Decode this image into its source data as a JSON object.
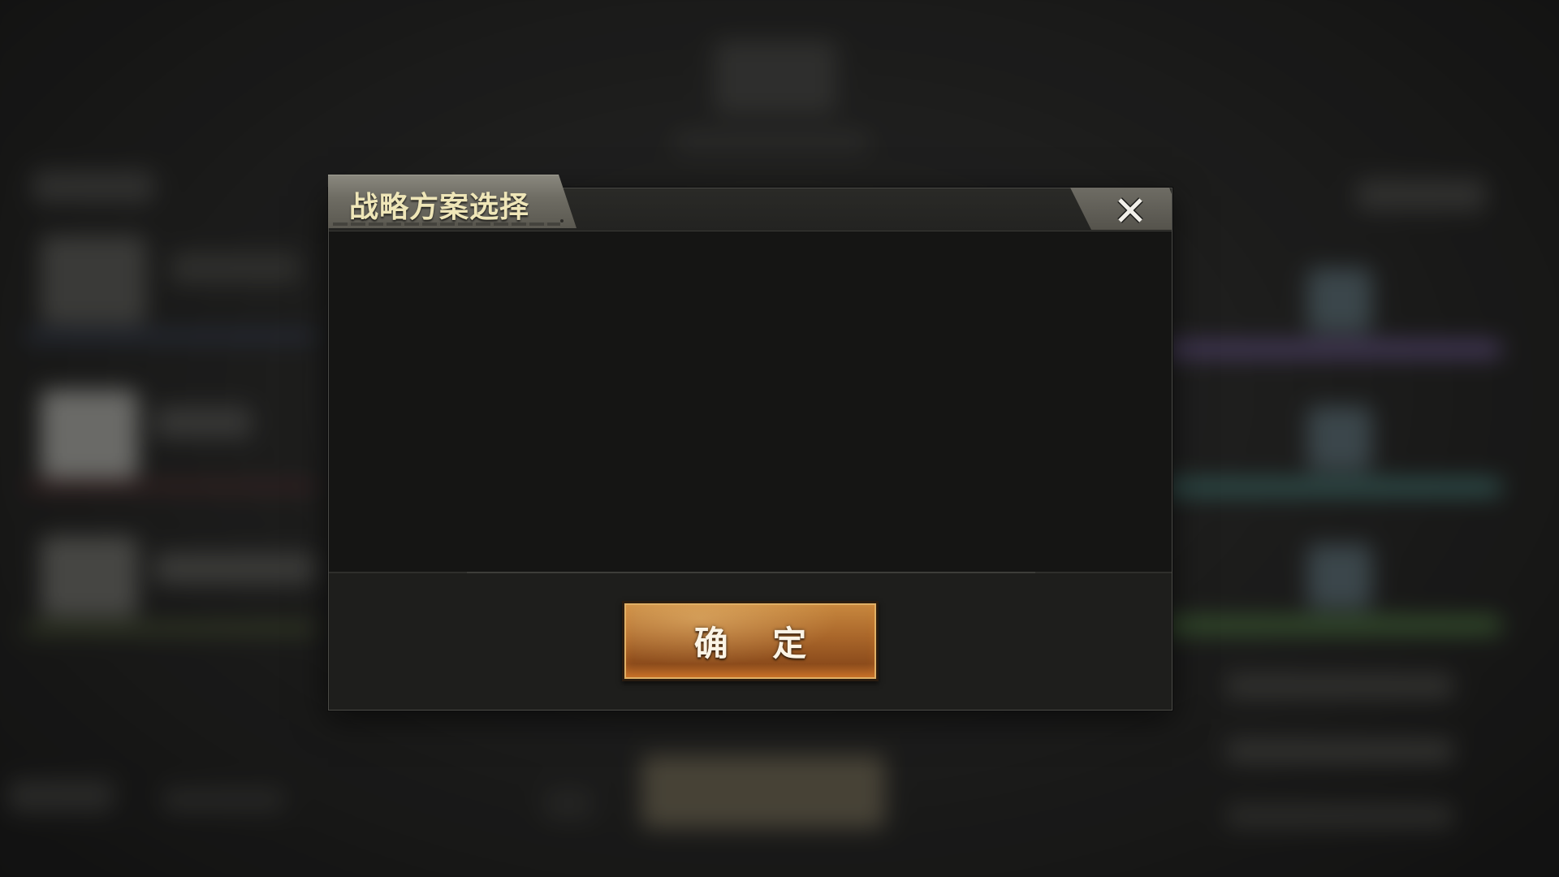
{
  "dialog": {
    "title": "战略方案选择",
    "confirm_label": "确 定"
  },
  "icons": {
    "close": "close-icon"
  },
  "colors": {
    "title_text": "#efe6b8",
    "confirm_button": "#a9662a",
    "panel_background": "#151514"
  }
}
